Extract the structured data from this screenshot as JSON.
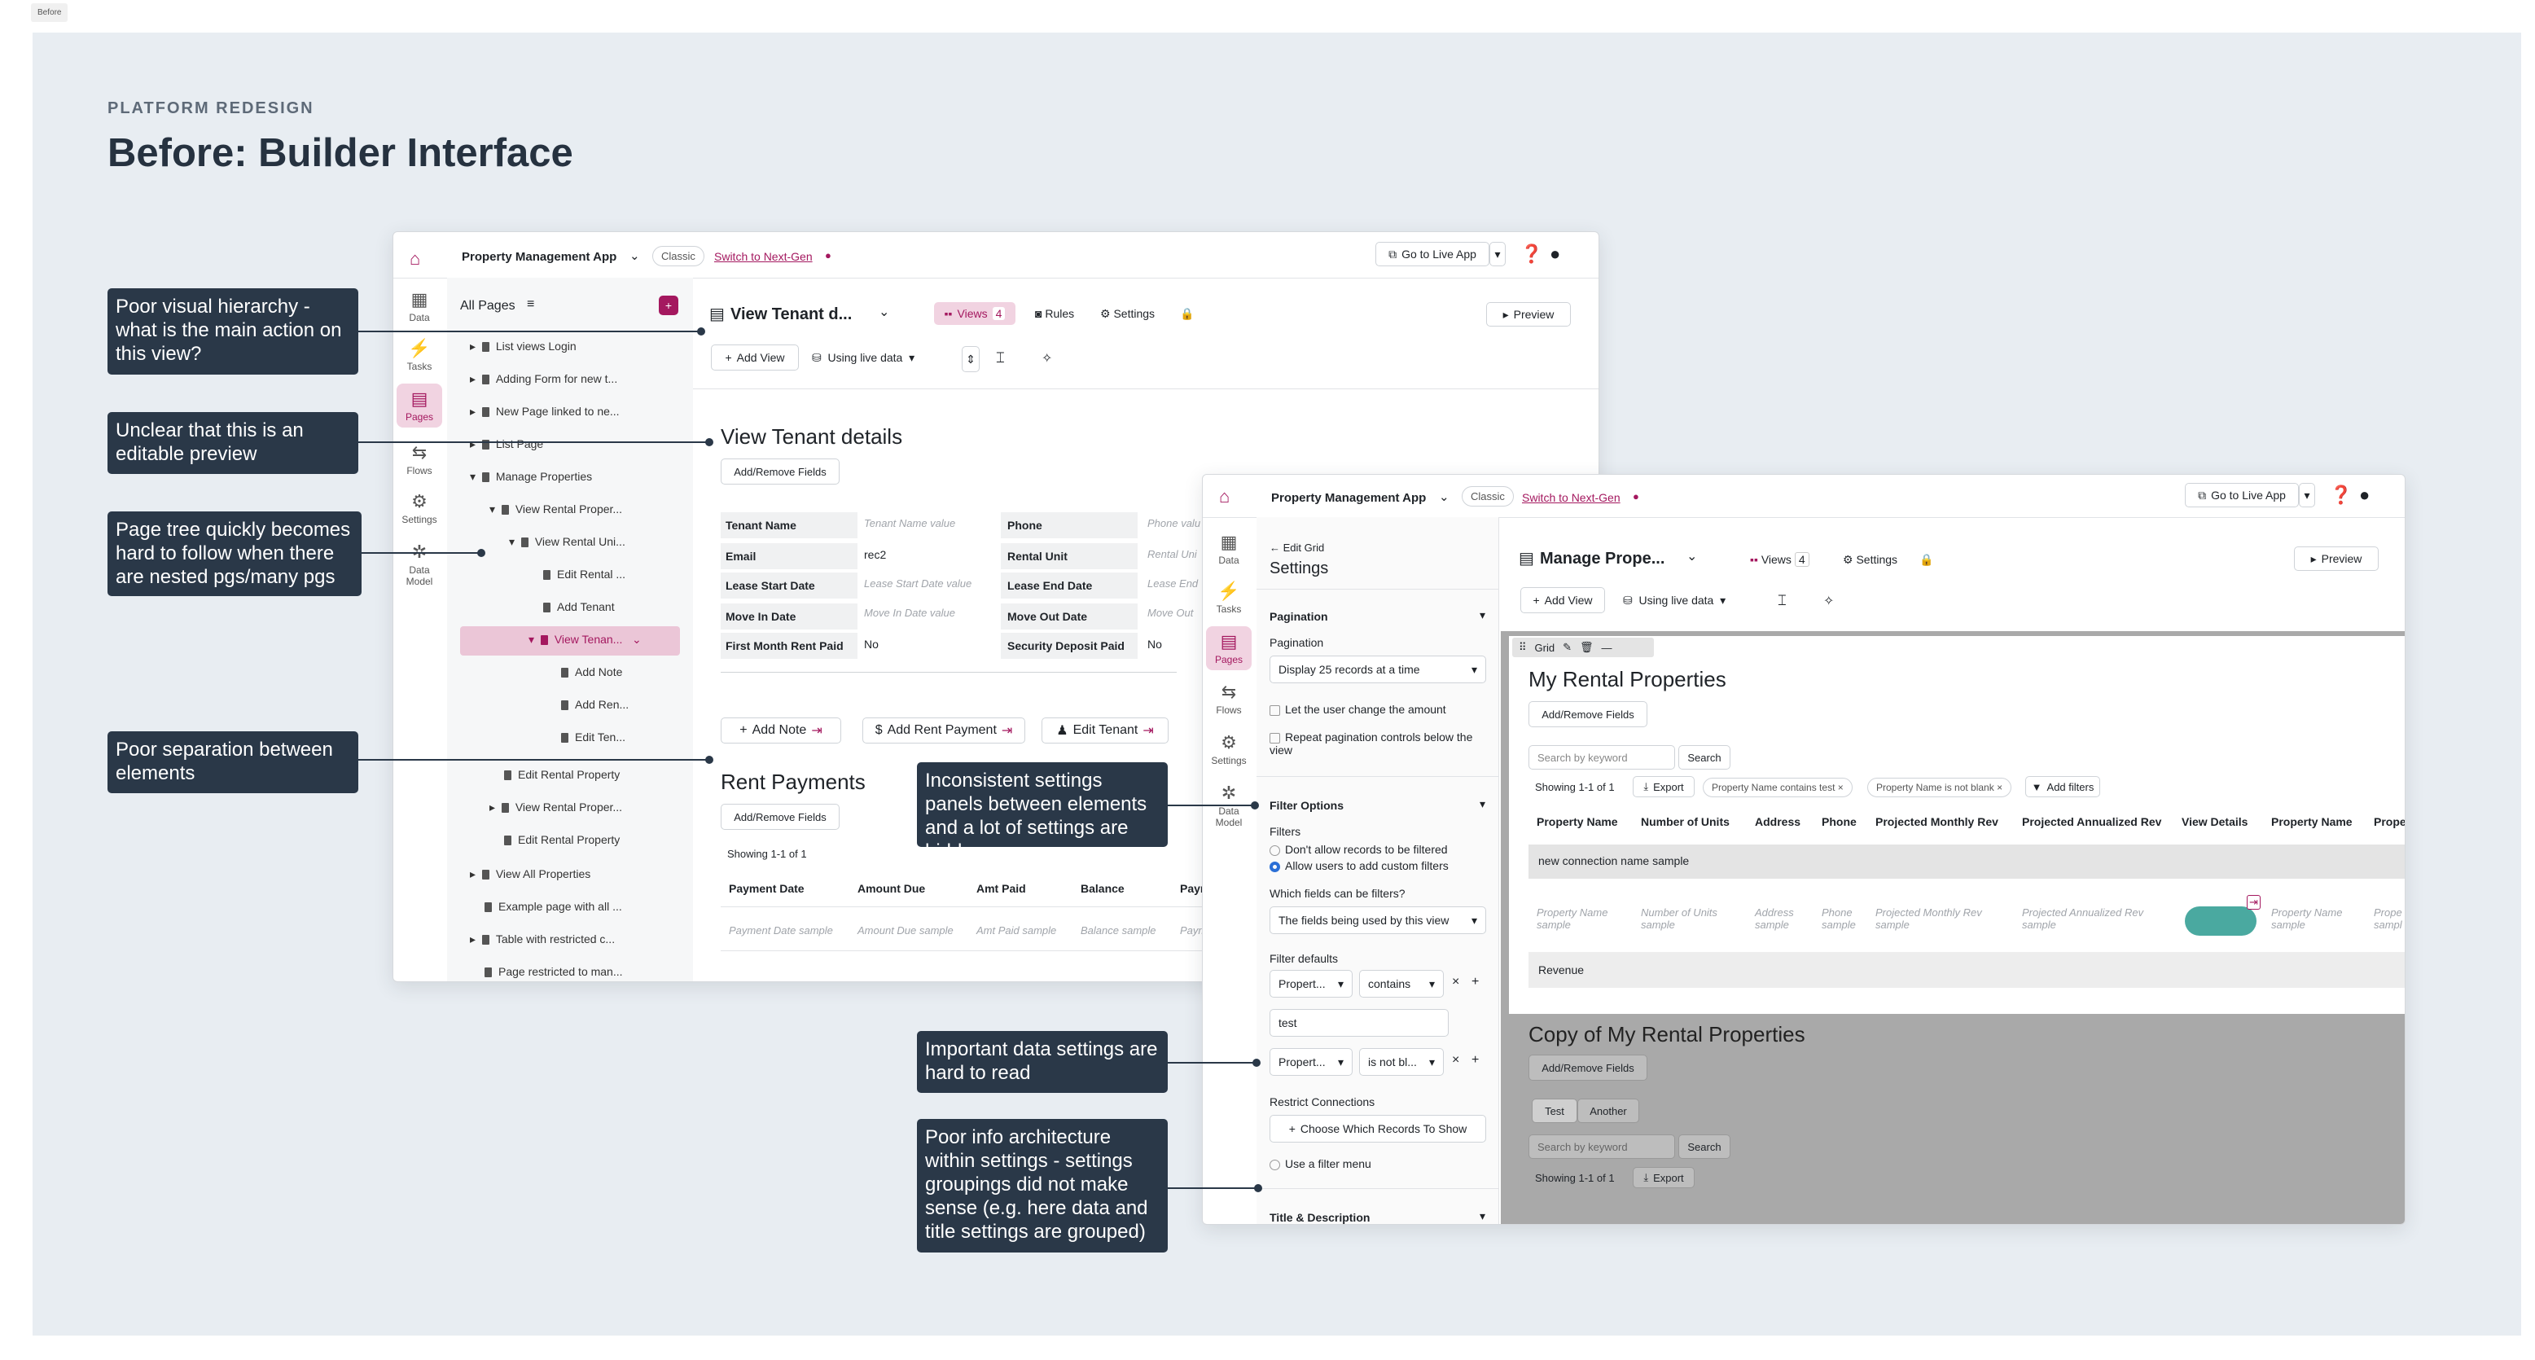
{
  "frame_tag": "Before",
  "kicker": "PLATFORM REDESIGN",
  "heading": "Before: Builder Interface",
  "app_bar": {
    "app_name": "Property Management App",
    "classic": "Classic",
    "switch": "Switch to Next-Gen",
    "go_live": "Go to Live App"
  },
  "rail": [
    "Data",
    "Tasks",
    "Pages",
    "Flows",
    "Settings",
    "Data Model"
  ],
  "win1": {
    "all_pages": "All Pages",
    "tree": [
      "List views Login",
      "Adding Form for new t...",
      "New Page linked to ne...",
      "List Page",
      "Manage Properties",
      "View Rental Proper...",
      "View Rental Uni...",
      "Edit Rental ...",
      "Add Tenant",
      "View Tenan...",
      "Add Note",
      "Add Ren...",
      "Edit Ten...",
      "Edit Rental Property",
      "View Rental Proper...",
      "Edit Rental Property",
      "View All Properties",
      "Example page with all ...",
      "Table with restricted c...",
      "Page restricted to man..."
    ],
    "page_title": "View Tenant d...",
    "views": "Views",
    "views_count": "4",
    "rules": "Rules",
    "settings": "Settings",
    "preview": "Preview",
    "add_view": "Add View",
    "live_data": "Using live data",
    "details_title": "View Tenant details",
    "add_remove": "Add/Remove Fields",
    "fields_left": [
      {
        "label": "Tenant Name",
        "value": "Tenant Name value"
      },
      {
        "label": "Email",
        "value": "rec2"
      },
      {
        "label": "Lease Start Date",
        "value": "Lease Start Date value"
      },
      {
        "label": "Move In Date",
        "value": "Move In Date value"
      },
      {
        "label": "First Month Rent Paid",
        "value": "No"
      }
    ],
    "fields_right": [
      {
        "label": "Phone",
        "value": "Phone valu"
      },
      {
        "label": "Rental Unit",
        "value": "Rental Uni"
      },
      {
        "label": "Lease End Date",
        "value": "Lease End"
      },
      {
        "label": "Move Out Date",
        "value": "Move Out"
      },
      {
        "label": "Security Deposit Paid",
        "value": "No"
      }
    ],
    "actions": [
      "Add Note",
      "Add Rent Payment",
      "Edit Tenant"
    ],
    "rent_title": "Rent Payments",
    "showing": "Showing 1-1 of 1",
    "rent_cols": [
      "Payment Date",
      "Amount Due",
      "Amt Paid",
      "Balance",
      "Paym"
    ],
    "rent_row": [
      "Payment Date sample",
      "Amount Due sample",
      "Amt Paid sample",
      "Balance sample",
      "Paym"
    ]
  },
  "win2": {
    "back": "Edit Grid",
    "settings_title": "Settings",
    "pagination": "Pagination",
    "pagination_label": "Pagination",
    "pagination_select": "Display 25 records at a time",
    "let_user": "Let the user change the amount",
    "repeat": "Repeat pagination controls below the view",
    "filter_options": "Filter Options",
    "filters": "Filters",
    "dont_allow": "Don't allow records to be filtered",
    "allow": "Allow users to add custom filters",
    "which_fields": "Which fields can be filters?",
    "fields_select": "The fields being used by this view",
    "filter_defaults": "Filter defaults",
    "fd1": [
      "Propert...",
      "contains"
    ],
    "fd1_value": "test",
    "fd2": [
      "Propert...",
      "is not bl..."
    ],
    "restrict": "Restrict Connections",
    "choose": "Choose Which Records To Show",
    "use_filter": "Use a filter menu",
    "title_desc": "Title & Description",
    "page_title": "Manage Prope...",
    "views": "Views",
    "views_count": "4",
    "settings": "Settings",
    "preview": "Preview",
    "add_view": "Add View",
    "live_data": "Using live data",
    "grid_label": "Grid",
    "grid_title": "My Rental Properties",
    "add_remove": "Add/Remove Fields",
    "search_ph": "Search by keyword",
    "search": "Search",
    "showing": "Showing 1-1 of 1",
    "export": "Export",
    "chips": [
      "Property Name contains test",
      "Property Name is not blank"
    ],
    "add_filters": "Add filters",
    "cols": [
      "Property Name",
      "Number of Units",
      "Address",
      "Phone",
      "Projected Monthly Rev",
      "Projected Annualized Rev",
      "View Details",
      "Property Name",
      "Prope"
    ],
    "group_row": "new connection name sample",
    "row": [
      "Property Name sample",
      "Number of Units sample",
      "Address sample",
      "Phone sample",
      "Projected Monthly Rev sample",
      "Projected Annualized Rev sample",
      "",
      "Property Name sample",
      "Prope sampl"
    ],
    "total_row": "Revenue",
    "copy_title": "Copy of My Rental Properties",
    "tabs": [
      "Test",
      "Another"
    ]
  },
  "callouts": [
    "Poor visual hierarchy - what is the main action on this view?",
    "Unclear that this is an editable preview",
    "Page tree quickly becomes hard to follow when there are nested pgs/many pgs",
    "Poor separation between elements",
    "Inconsistent settings panels between elements and a lot of settings are hidden",
    "Important data settings are hard to read",
    "Poor info architecture within settings - settings groupings did not make sense (e.g. here data and title settings are grouped)"
  ],
  "colors": {
    "accent": "#a4185f",
    "canvas": "#e8edf2",
    "callout": "#2a3848",
    "teal": "#4aa9a0"
  }
}
